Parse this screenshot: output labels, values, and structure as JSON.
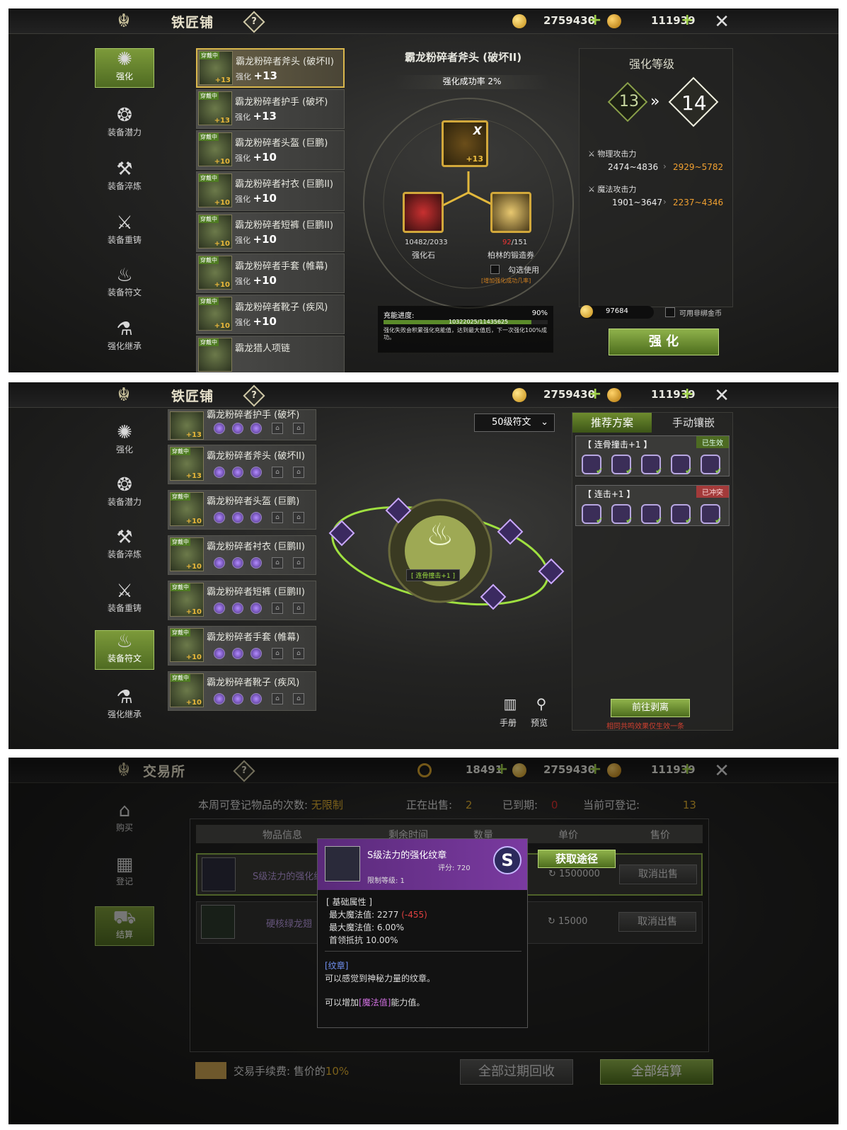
{
  "blacksmith": {
    "title": "铁匠铺",
    "help": "?",
    "gold": "2759430",
    "diamond": "111939",
    "nav": [
      "强化",
      "装备潜力",
      "装备淬炼",
      "装备重铸",
      "装备符文",
      "强化继承"
    ],
    "items": [
      {
        "wear": "穿戴中",
        "name": "霸龙粉碎者斧头 (破坏II)",
        "plus": "+13",
        "level_label": "强化",
        "level": "+13"
      },
      {
        "wear": "穿戴中",
        "name": "霸龙粉碎者护手 (破坏)",
        "plus": "+13",
        "level_label": "强化",
        "level": "+13"
      },
      {
        "wear": "穿戴中",
        "name": "霸龙粉碎者头盔 (巨鹏)",
        "plus": "+10",
        "level_label": "强化",
        "level": "+10"
      },
      {
        "wear": "穿戴中",
        "name": "霸龙粉碎者衬衣 (巨鹏II)",
        "plus": "+10",
        "level_label": "强化",
        "level": "+10"
      },
      {
        "wear": "穿戴中",
        "name": "霸龙粉碎者短裤 (巨鹏II)",
        "plus": "+10",
        "level_label": "强化",
        "level": "+10"
      },
      {
        "wear": "穿戴中",
        "name": "霸龙粉碎者手套 (帷幕)",
        "plus": "+10",
        "level_label": "强化",
        "level": "+10"
      },
      {
        "wear": "穿戴中",
        "name": "霸龙粉碎者靴子 (疾风)",
        "plus": "+10",
        "level_label": "强化",
        "level": "+10"
      },
      {
        "wear": "穿戴中",
        "name": "霸龙猎人项链",
        "plus": "",
        "level_label": "",
        "level": ""
      }
    ],
    "center": {
      "item_name": "霸龙粉碎者斧头 (破坏II)",
      "success_rate": "强化成功率 2%",
      "main_plus": "+13",
      "main_x": "X",
      "stone_count": "10482/2033",
      "stone_label": "强化石",
      "ticket_have": "92",
      "ticket_need": "/151",
      "ticket_label": "柏林的锻造券",
      "check_label": "勾选使用",
      "check_note": "[增加强化成功几率]",
      "charge_label": "充能进度:",
      "charge_pct": "90%",
      "charge_value": "10322025/11435625",
      "charge_progress": 0.9,
      "charge_desc": "强化失败会积累强化充能值，达到最大值后，下一次强化100%成功。"
    },
    "right": {
      "title": "强化等级",
      "from": "13",
      "to": "14",
      "phys_label": "物理攻击力",
      "phys_cur": "2474~4836",
      "phys_next": "2929~5782",
      "mag_label": "魔法攻击力",
      "mag_cur": "1901~3647",
      "mag_next": "2237~4346",
      "cost": "97684",
      "unbound_label": "可用非绑金币",
      "enhance_btn": "强 化"
    }
  },
  "rune": {
    "title": "铁匠铺",
    "gold": "2759430",
    "diamond": "111939",
    "nav": [
      "强化",
      "装备潜力",
      "装备淬炼",
      "装备重铸",
      "装备符文",
      "强化继承"
    ],
    "items": [
      {
        "wear": "",
        "name": "霸龙粉碎者护手 (破坏)",
        "plus": "+13"
      },
      {
        "wear": "穿戴中",
        "name": "霸龙粉碎者斧头 (破坏II)",
        "plus": "+13"
      },
      {
        "wear": "穿戴中",
        "name": "霸龙粉碎者头盔 (巨鹏)",
        "plus": "+10"
      },
      {
        "wear": "穿戴中",
        "name": "霸龙粉碎者衬衣 (巨鹏II)",
        "plus": "+10"
      },
      {
        "wear": "穿戴中",
        "name": "霸龙粉碎者短裤 (巨鹏II)",
        "plus": "+10"
      },
      {
        "wear": "穿戴中",
        "name": "霸龙粉碎者手套 (帷幕)",
        "plus": "+10"
      },
      {
        "wear": "穿戴中",
        "name": "霸龙粉碎者靴子 (疾风)",
        "plus": "+10"
      }
    ],
    "filter": "50级符文",
    "center_label": "[ 连骨撞击+1 ]",
    "tab_rec": "推荐方案",
    "tab_manual": "手动镶嵌",
    "plan1_name": "【 连骨撞击+1 】",
    "plan1_status": "已生效",
    "plan2_name": "【 连击+1 】",
    "plan2_status": "已冲突",
    "manual_btn": "手册",
    "preview_btn": "预览",
    "go_btn": "前往剥离",
    "footnote": "相同共鸣效果仅生效一条"
  },
  "trade": {
    "title": "交易所",
    "help": "?",
    "ring_cur": "18491",
    "gold": "2759430",
    "diamond": "111939",
    "nav": [
      "购买",
      "登记",
      "结算"
    ],
    "week_label": "本周可登记物品的次数:",
    "week_val": "无限制",
    "selling_label": "正在出售:",
    "selling_val": "2",
    "expired_label": "已到期:",
    "expired_val": "0",
    "can_reg_label": "当前可登记:",
    "can_reg_val": "13",
    "cols": [
      "物品信息",
      "剩余时间",
      "数量",
      "单价",
      "售价"
    ],
    "row1_name": "S级法力的强化纹章",
    "row1_price": "1500000",
    "row1_btn": "取消出售",
    "row2_name": "硬核绿龙翅",
    "row2_price": "15000",
    "row2_btn": "取消出售",
    "fee_label": "交易手续费: 售价的",
    "fee_val": "10%",
    "reclaim_btn": "全部过期回收",
    "settle_btn": "全部结算",
    "tip": {
      "name": "S级法力的强化纹章",
      "score": "评分: 720",
      "limit": "限制等级: 1",
      "grade": "S",
      "acquire": "获取途径",
      "base_title": "[ 基础属性 ]",
      "stat1": "最大魔法值: 2277",
      "stat1_diff": "(-455)",
      "stat2": "最大魔法值: 6.00%",
      "stat3": "首领抵抗 10.00%",
      "cat": "[纹章]",
      "desc1": "可以感觉到神秘力量的纹章。",
      "desc2_a": "可以增加",
      "desc2_b": "[魔法值]",
      "desc2_c": "能力值。"
    }
  }
}
